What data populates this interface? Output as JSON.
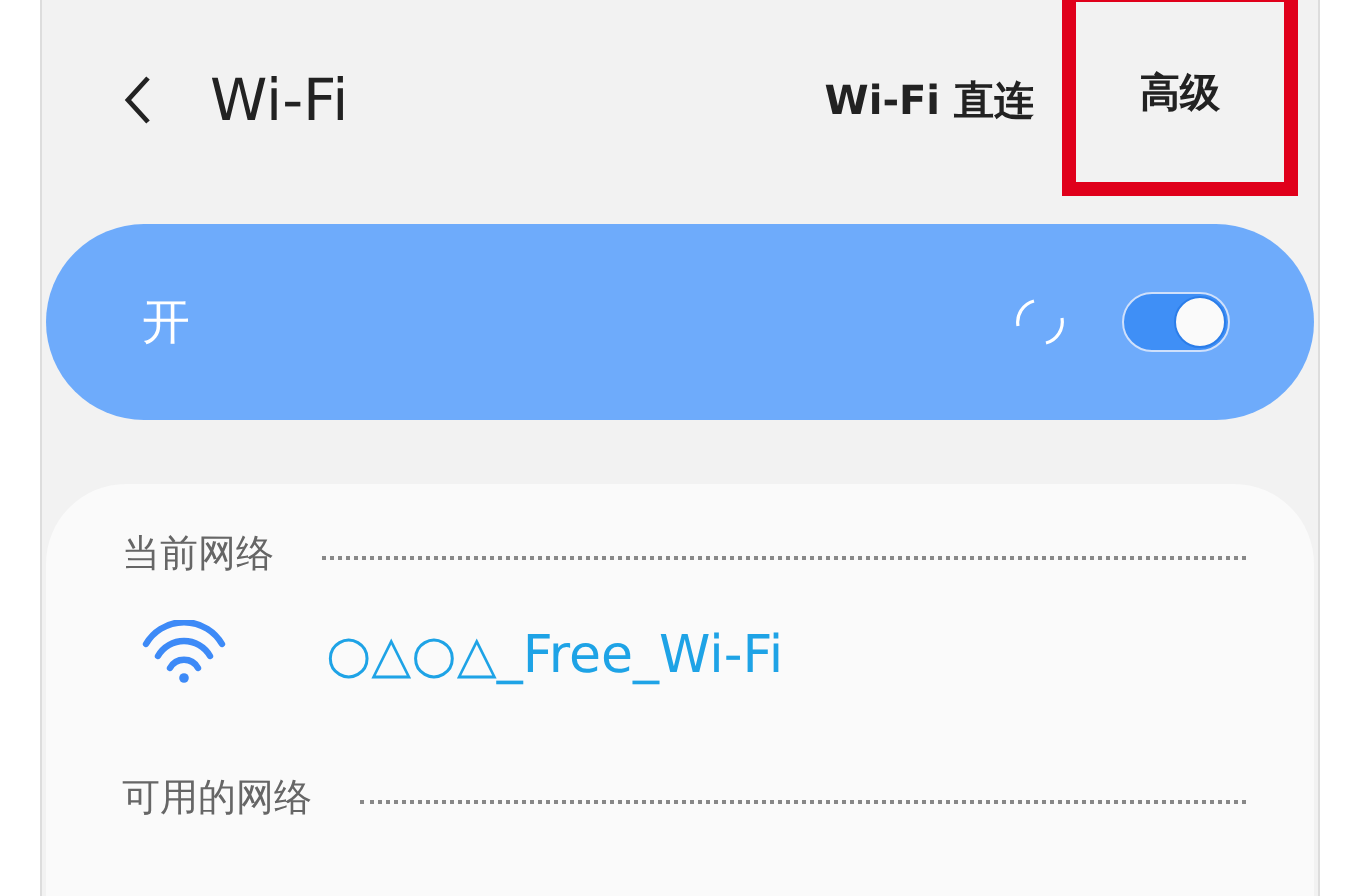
{
  "header": {
    "title": "Wi-Fi",
    "actions": [
      {
        "label": "Wi-Fi 直连",
        "highlighted": false
      },
      {
        "label": "高级",
        "highlighted": true
      }
    ]
  },
  "master_switch": {
    "label": "开",
    "on": true,
    "busy": true
  },
  "sections": [
    {
      "title": "当前网络",
      "networks": [
        {
          "name": "○△○△_Free_Wi-Fi",
          "connected": true
        }
      ]
    },
    {
      "title": "可用的网络"
    }
  ]
}
